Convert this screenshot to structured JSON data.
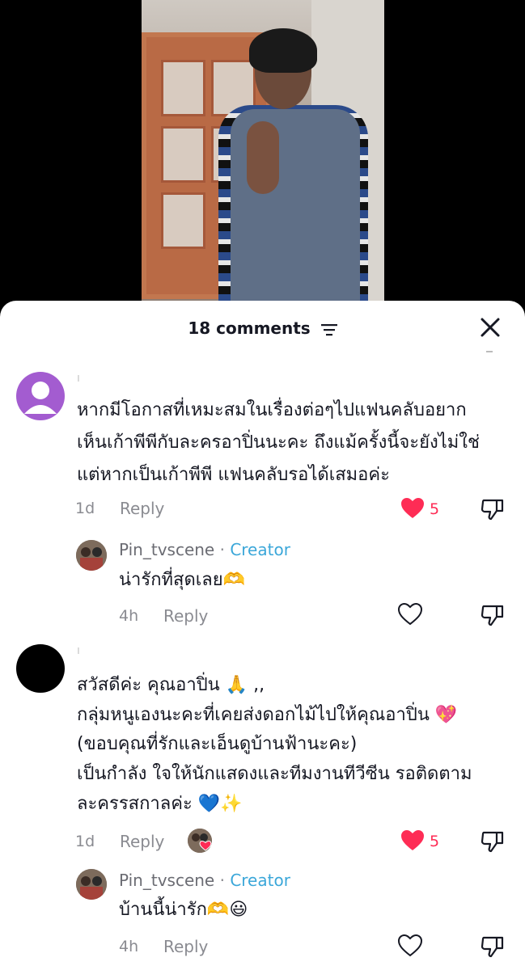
{
  "header": {
    "comment_count": "18 comments"
  },
  "colors": {
    "accent_red": "#fe2c55",
    "creator_blue": "#3ba7d9",
    "muted_text": "#8a8b91",
    "avatar_purple": "#a35cd0"
  },
  "icons": {
    "filter": "filter-icon",
    "close": "close-icon",
    "like": "heart-icon",
    "dislike": "thumbs-down-icon"
  },
  "comments": [
    {
      "username": "ı",
      "lines": [
        "หากมีโอกาสที่เหมะสมในเรื่องต่อๆไปแฟนคลับอยาก",
        "เห็นเก้าพีพีกับละครอาปิ่นนะคะ ถึงแม้ครั้งนี้จะยังไม่ใช่",
        "แต่หากเป็นเก้าพีพี แฟนคลับรอได้เสมอค่ะ"
      ],
      "time": "1d",
      "reply_label": "Reply",
      "likes": "5",
      "reply": {
        "username": "Pin_tvscene",
        "separator": "·",
        "badge": "Creator",
        "text": "น่ารักที่สุดเลย🫶",
        "time": "4h",
        "reply_label": "Reply"
      }
    },
    {
      "username": "ı",
      "lines": [
        "สวัสดีค่ะ คุณอาปิ่น 🙏 ,,",
        "กลุ่มหนูเองนะคะที่เคยส่งดอกไม้ไปให้คุณอาปิ่น 💖",
        "(ขอบคุณที่รักและเอ็นดูบ้านฟ้านะคะ)",
        "เป็นกำลัง ใจให้นักแสดงและทีมงานทีวีซีน รอติดตาม",
        "ละครรสกาลค่ะ 💙✨"
      ],
      "time": "1d",
      "reply_label": "Reply",
      "likes": "5",
      "reply": {
        "username": "Pin_tvscene",
        "separator": "·",
        "badge": "Creator",
        "text": "บ้านนี้น่ารัก🫶😃",
        "time": "4h",
        "reply_label": "Reply"
      }
    }
  ]
}
